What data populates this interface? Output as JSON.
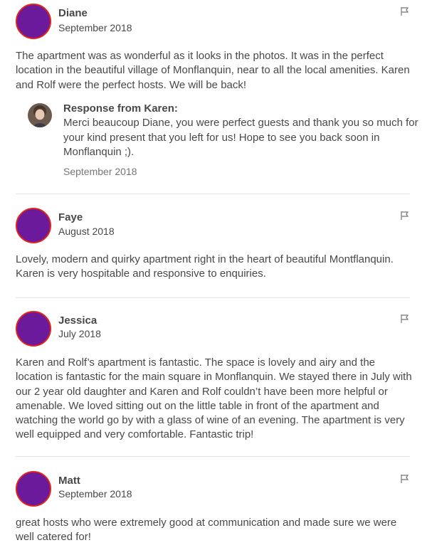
{
  "reviews": [
    {
      "name": "Diane",
      "date": "September 2018",
      "text": "The apartment was as wonderful as it looks in the photos. It was in the perfect location in the beautiful village of Monflanquin, near to all the local amenities. Karen and Rolf were the perfect hosts. We will be back!",
      "response": {
        "title": "Response from Karen:",
        "text": "Merci beaucoup Diane, you were perfect guests and thank you so much for your kind present that you left for us! Hope to see you back soon in Monflanquin ;).",
        "date": "September 2018"
      }
    },
    {
      "name": "Faye",
      "date": "August 2018",
      "text": "Lovely, modern and quirky apartment right in the heart of beautiful Montflanquin. Karen is very hospitable and responsive to enquiries."
    },
    {
      "name": "Jessica",
      "date": "July 2018",
      "text": "Karen and Rolf’s apartment is fantastic. The space is lovely and airy and the location is fantastic for the main square in Monflanquin. We stayed there in July with our 2 year old daughter and Karen and Rolf couldn’t have been more helpful or amenable. We loved sitting out on the little table in front of the apartment and watching the world go by with a glass of wine of an evening. The apartment is very well equipped and very comfortable. Fantastic trip!"
    },
    {
      "name": "Matt",
      "date": "September 2018",
      "text": "great hosts who were extremely good at communication and made sure we were well catered for!"
    }
  ],
  "colors": {
    "avatar_fill": "#6a1a9a",
    "avatar_ring": "#e2231a",
    "text": "#484848",
    "muted": "#767676",
    "divider": "#e4e4e4"
  },
  "icons": {
    "report": "flag-icon"
  }
}
